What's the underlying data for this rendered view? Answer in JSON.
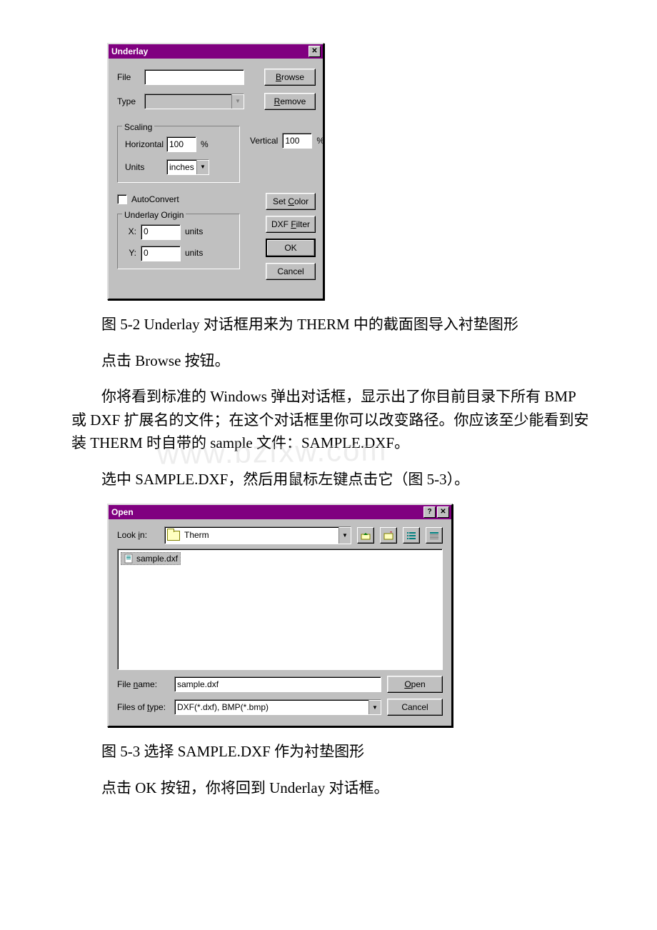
{
  "watermark": "www.bzfxw.com",
  "underlayDlg": {
    "title": "Underlay",
    "file_label": "File",
    "type_label": "Type",
    "browse_label": "Browse",
    "browse_u": "B",
    "remove_label": "Remove",
    "remove_u": "R",
    "scaling_legend": "Scaling",
    "horizontal_label": "Horizontal",
    "horizontal_value": "100",
    "vertical_label": "Vertical",
    "vertical_value": "100",
    "percent": "%",
    "units_label": "Units",
    "units_value": "inches",
    "autoconvert_label": "AutoConvert",
    "origin_legend": "Underlay Origin",
    "x_label": "X:",
    "x_value": "0",
    "y_label": "Y:",
    "y_value": "0",
    "units_word": "units",
    "setcolor_label": "Set Color",
    "setcolor_u": "C",
    "dxffilter_label": "DXF Filter",
    "dxffilter_u": "F",
    "ok_label": "OK",
    "cancel_label": "Cancel"
  },
  "caption1": "图 5-2 Underlay 对话框用来为 THERM 中的截面图导入衬垫图形",
  "line_click_browse": "点击 Browse 按钮。",
  "para_main": "你将看到标准的 Windows 弹出对话框，显示出了你目前目录下所有 BMP 或 DXF 扩展名的文件；在这个对话框里你可以改变路径。你应该至少能看到安装 THERM 时自带的 sample 文件：SAMPLE.DXF。",
  "line_select_sample": "选中 SAMPLE.DXF，然后用鼠标左键点击它（图 5-3）。",
  "openDlg": {
    "title": "Open",
    "lookin_label": "Look in:",
    "lookin_u": "i",
    "lookin_value": "Therm",
    "file_item": "sample.dxf",
    "filename_label": "File name:",
    "filename_u": "n",
    "filename_value": "sample.dxf",
    "filetype_label": "Files of type:",
    "filetype_u": "t",
    "filetype_value": "DXF(*.dxf), BMP(*.bmp)",
    "open_label": "Open",
    "open_u": "O",
    "cancel_label": "Cancel"
  },
  "caption2": "图 5-3 选择 SAMPLE.DXF 作为衬垫图形",
  "line_click_ok": "点击 OK 按钮，你将回到 Underlay 对话框。"
}
